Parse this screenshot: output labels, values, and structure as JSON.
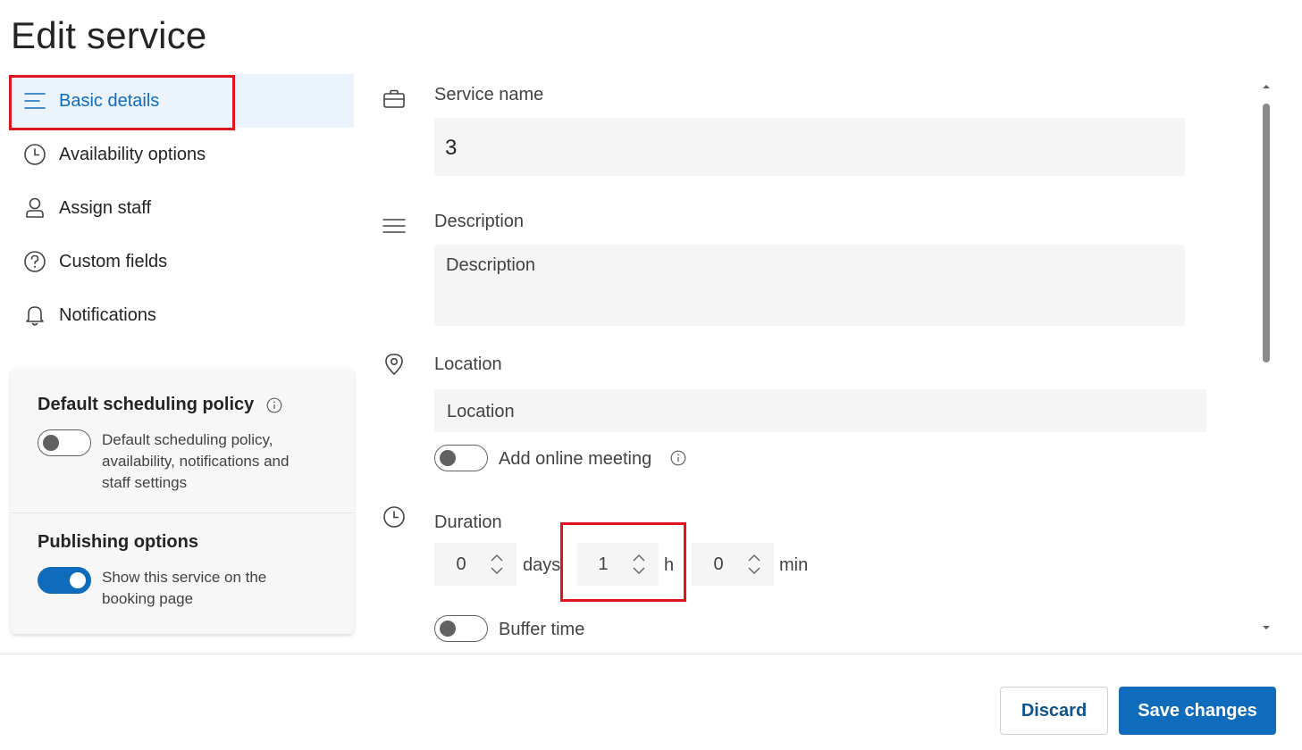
{
  "page": {
    "title": "Edit service"
  },
  "nav": {
    "items": [
      {
        "label": "Basic details",
        "icon": "lines-icon",
        "active": true
      },
      {
        "label": "Availability options",
        "icon": "clock-icon"
      },
      {
        "label": "Assign staff",
        "icon": "person-icon"
      },
      {
        "label": "Custom fields",
        "icon": "question-circle-icon"
      },
      {
        "label": "Notifications",
        "icon": "bell-icon"
      }
    ]
  },
  "policy": {
    "default_heading": "Default scheduling policy",
    "default_text": "Default scheduling policy, availability, notifications and staff settings",
    "default_enabled": false,
    "publishing_heading": "Publishing options",
    "publishing_text": "Show this service on the booking page",
    "publishing_enabled": true
  },
  "form": {
    "service_name": {
      "label": "Service name",
      "value": "3",
      "icon": "briefcase-icon"
    },
    "description": {
      "label": "Description",
      "placeholder": "Description",
      "icon": "lines-icon"
    },
    "location": {
      "label": "Location",
      "placeholder": "Location",
      "icon": "location-pin-icon"
    },
    "online_meeting": {
      "label": "Add online meeting",
      "enabled": false
    },
    "duration": {
      "label": "Duration",
      "icon": "clock-icon",
      "days": "0",
      "days_unit": "days",
      "hours": "1",
      "hours_unit": "h",
      "minutes": "0",
      "minutes_unit": "min"
    },
    "buffer_time": {
      "label": "Buffer time",
      "enabled": false
    }
  },
  "footer": {
    "discard_label": "Discard",
    "save_label": "Save changes"
  },
  "colors": {
    "accent": "#0f6cbd",
    "highlight": "#e0141e",
    "active_bg": "#ebf3fc"
  }
}
